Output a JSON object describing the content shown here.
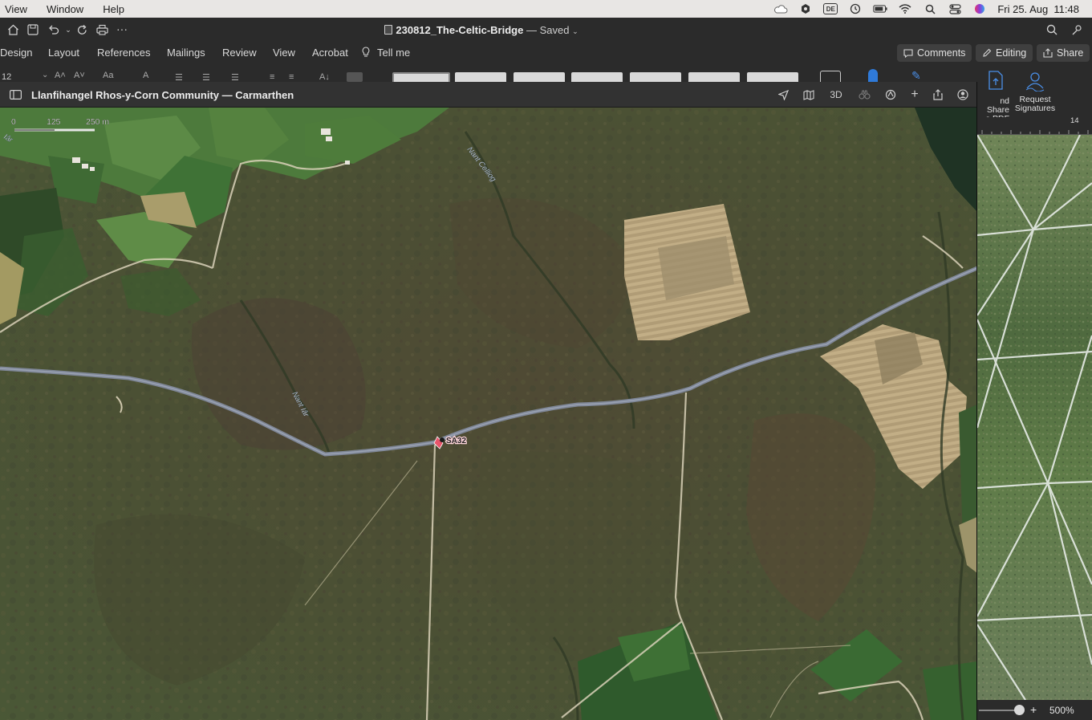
{
  "menubar": {
    "items": [
      "View",
      "Window",
      "Help"
    ],
    "clock": "Fri 25. Aug  11:48",
    "input_source": "DE"
  },
  "word": {
    "doc_name": "230812_The-Celtic-Bridge",
    "status": "— Saved",
    "tabs": [
      "Design",
      "Layout",
      "References",
      "Mailings",
      "Review",
      "View",
      "Acrobat"
    ],
    "tell_me": "Tell me",
    "comments_label": "Comments",
    "editing_label": "Editing",
    "share_label": "Share",
    "font_size": "12",
    "acrobat": {
      "create_share_line1": "nd Share",
      "create_share_line2": "e PDF",
      "request_line1": "Request",
      "request_line2": "Signatures"
    },
    "ruler_number": "14",
    "zoom_level": "500%"
  },
  "maps": {
    "title": "Llanfihangel Rhos-y-Corn Community — Carmarthen",
    "toolbar_3d": "3D",
    "scale": {
      "zero": "0",
      "mid": "125",
      "end": "250 m"
    },
    "road_label": "SA32",
    "stream_labels": [
      "Nant Celliog",
      "Nant Iâr",
      "Iâr"
    ]
  },
  "colors": {
    "menubar_bg": "#e8e6e4",
    "chrome_bg": "#2b2b2b",
    "map_base": "#4a4f33",
    "marker": "#e8556b"
  }
}
